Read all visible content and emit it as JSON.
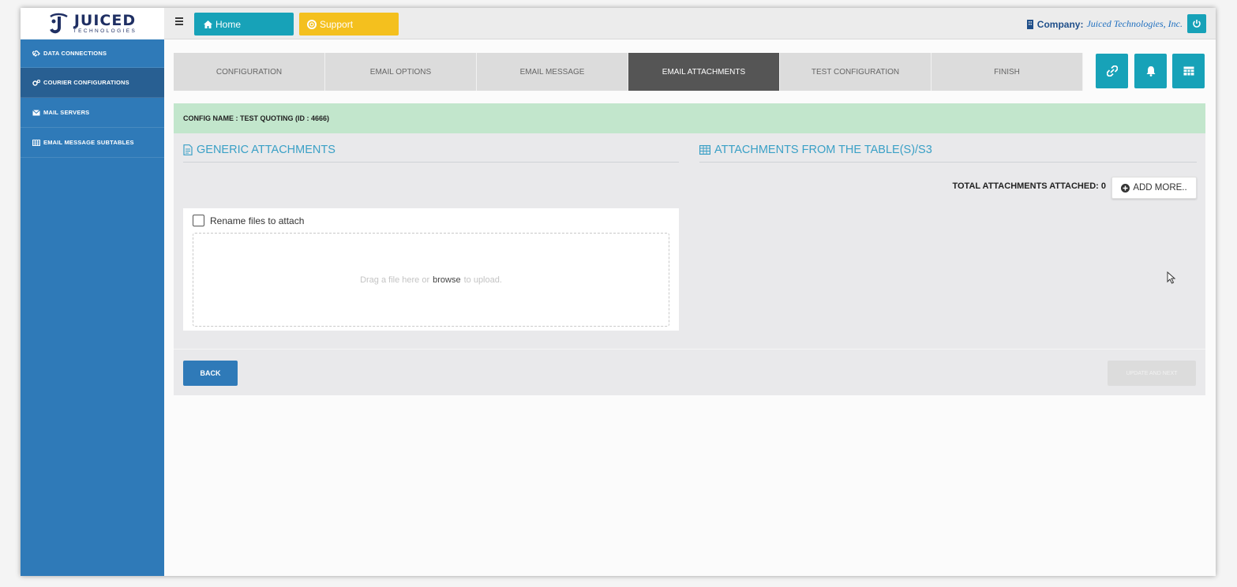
{
  "logo": {
    "main": "JUICED",
    "sub": "TECHNOLOGIES"
  },
  "sidebar": {
    "items": [
      {
        "label": "DATA CONNECTIONS"
      },
      {
        "label": "COURIER CONFIGURATIONS"
      },
      {
        "label": "MAIL SERVERS"
      },
      {
        "label": "EMAIL MESSAGE SUBTABLES"
      }
    ]
  },
  "topbar": {
    "home_label": "Home",
    "support_label": "Support",
    "company_label": "Company:",
    "company_name": "Juiced Technologies, Inc."
  },
  "wizard": {
    "tabs": [
      {
        "label": "CONFIGURATION"
      },
      {
        "label": "EMAIL OPTIONS"
      },
      {
        "label": "EMAIL MESSAGE"
      },
      {
        "label": "EMAIL ATTACHMENTS"
      },
      {
        "label": "TEST CONFIGURATION"
      },
      {
        "label": "FINISH"
      }
    ],
    "active_index": 3
  },
  "config": {
    "name_text": "CONFIG NAME : TEST QUOTING (ID : 4666)"
  },
  "generic": {
    "title": "GENERIC ATTACHMENTS",
    "rename_label": "Rename files to attach",
    "rename_checked": false,
    "drop_before": "Drag a file here or",
    "drop_link": "browse",
    "drop_after": "to upload."
  },
  "table_attachments": {
    "title": "ATTACHMENTS FROM THE TABLE(S)/S3",
    "total_label": "TOTAL ATTACHMENTS ATTACHED: 0",
    "add_more_label": "ADD MORE.."
  },
  "footer": {
    "back_label": "BACK",
    "update_label": "UPDATE AND NEXT"
  },
  "icons": {
    "wizard_buttons": [
      "link-icon",
      "bell-icon",
      "table-icon"
    ]
  },
  "colors": {
    "sidebar": "#2f7ab8",
    "accent": "#17a2b8",
    "support": "#f4c01e",
    "config_bar": "#c2e6cc",
    "active_tab": "#555555"
  }
}
